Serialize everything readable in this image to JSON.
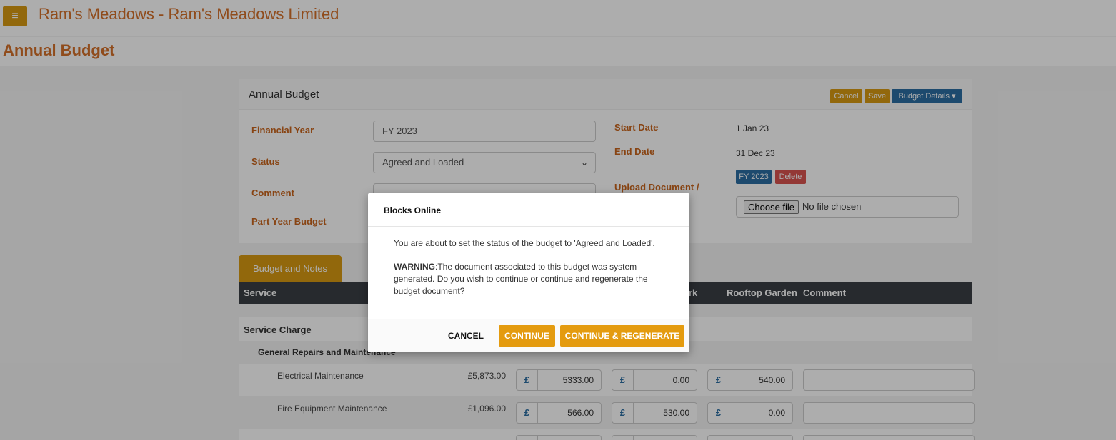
{
  "header": {
    "menu_icon": "hamburger-icon",
    "app_title": "Ram's Meadows - Ram's Meadows Limited"
  },
  "page": {
    "title": "Annual Budget"
  },
  "panel": {
    "title": "Annual Budget",
    "buttons": {
      "cancel": "Cancel",
      "save": "Save",
      "details": "Budget Details ▾"
    },
    "fields": {
      "financial_year": {
        "label": "Financial Year",
        "value": "FY 2023"
      },
      "status": {
        "label": "Status",
        "value": "Agreed and Loaded"
      },
      "comment": {
        "label": "Comment",
        "value": ""
      },
      "part_year": {
        "label": "Part Year Budget"
      },
      "start_date": {
        "label": "Start Date",
        "value": "1 Jan 23"
      },
      "end_date": {
        "label": "End Date",
        "value": "31 Dec 23"
      },
      "upload": {
        "label": "Upload Document /",
        "doc_badge": "FY 2023",
        "delete_badge": "Delete",
        "choose_file": "Choose file",
        "no_file": "No file chosen"
      }
    }
  },
  "tabs": {
    "budget_notes": "Budget and Notes"
  },
  "grid": {
    "headers": {
      "service": "Service",
      "col_partial": "rk",
      "rooftop": "Rooftop Garden",
      "comment": "Comment"
    },
    "section": "Service Charge",
    "subsection": "General Repairs and Maintenance",
    "currency_symbol": "£",
    "rows": [
      {
        "name": "Electrical Maintenance",
        "total": "£5,873.00",
        "v1": "5333.00",
        "v2": "0.00",
        "v3": "540.00"
      },
      {
        "name": "Fire Equipment Maintenance",
        "total": "£1,096.00",
        "v1": "566.00",
        "v2": "530.00",
        "v3": "0.00"
      }
    ]
  },
  "modal": {
    "title": "Blocks Online",
    "message": "You are about to set the status of the budget to 'Agreed and Loaded'.",
    "warning_label": "WARNING",
    "warning_text": ":The document associated to this budget was system generated. Do you wish to continue or continue and regenerate the budget document?",
    "buttons": {
      "cancel": "CANCEL",
      "continue": "CONTINUE",
      "regenerate": "CONTINUE & REGENERATE"
    }
  },
  "colors": {
    "accent_orange": "#d89a12",
    "title_orange": "#d4702a",
    "blue": "#2b6ea3",
    "delete_red": "#d9534f",
    "grid_header": "#3a3f44"
  }
}
